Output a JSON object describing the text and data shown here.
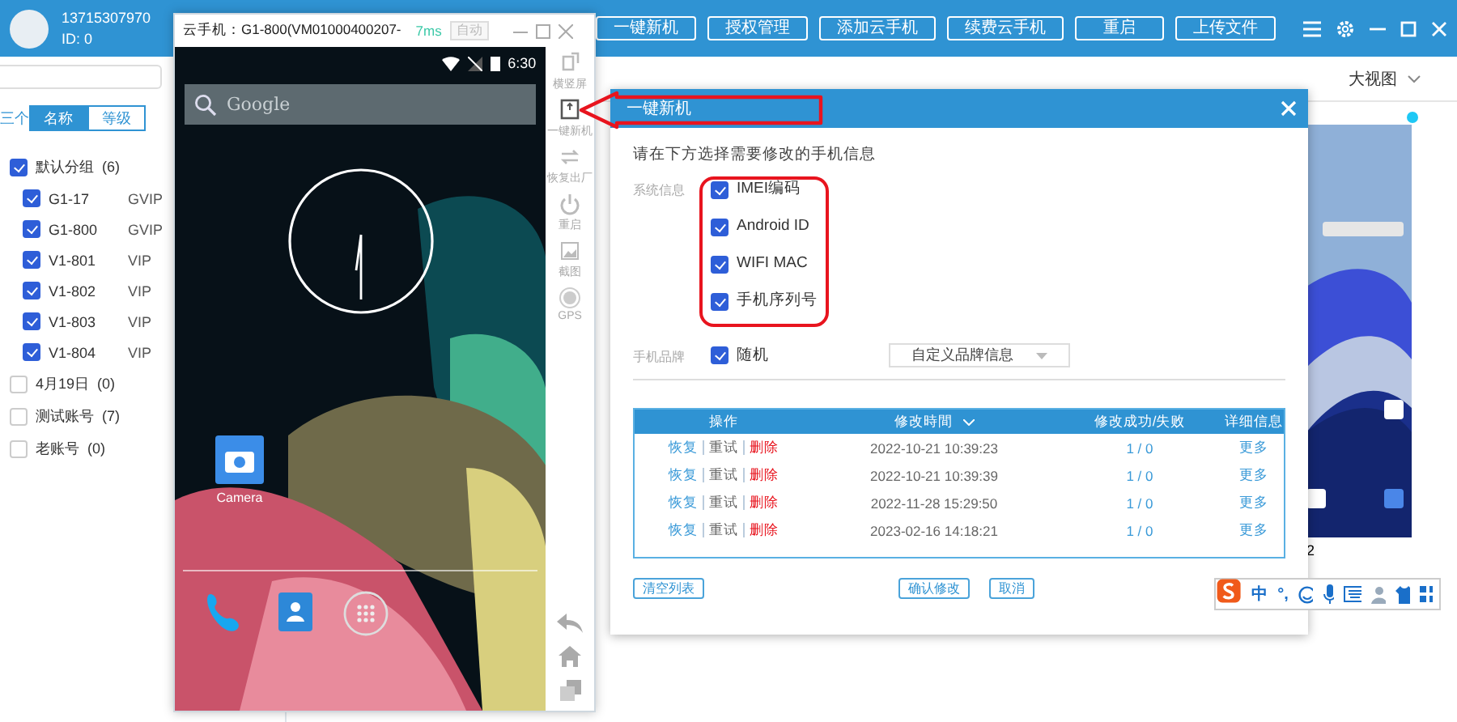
{
  "header": {
    "account": "13715307970",
    "user_id": "ID: 0",
    "buttons": [
      "一键新机",
      "授权管理",
      "添加云手机",
      "续费云手机",
      "重启",
      "上传文件"
    ]
  },
  "sidebar": {
    "sort_label": "三个",
    "sort_tabs": [
      {
        "label": "名称",
        "selected": true
      },
      {
        "label": "等级",
        "selected": false
      }
    ],
    "groups": [
      {
        "name": "默认分组",
        "count": "(6)",
        "checked": true,
        "children": [
          {
            "name": "G1-17",
            "grade": "GVIP",
            "checked": true
          },
          {
            "name": "G1-800",
            "grade": "GVIP",
            "checked": true
          },
          {
            "name": "V1-801",
            "grade": "VIP",
            "checked": true
          },
          {
            "name": "V1-802",
            "grade": "VIP",
            "checked": true
          },
          {
            "name": "V1-803",
            "grade": "VIP",
            "checked": true
          },
          {
            "name": "V1-804",
            "grade": "VIP",
            "checked": true
          }
        ]
      },
      {
        "name": "4月19日",
        "count": "(0)",
        "checked": false
      },
      {
        "name": "测试账号",
        "count": "(7)",
        "checked": false
      },
      {
        "name": "老账号",
        "count": "(0)",
        "checked": false
      }
    ]
  },
  "main": {
    "view_menu": "大视图",
    "devices": [
      {
        "label": "2",
        "online": true
      }
    ]
  },
  "phone_window": {
    "title": "云手机：G1-800(VM01000400207-",
    "ping": "7ms",
    "auto_button": "自动",
    "status_time": "6:30",
    "search_placeholder": "Google",
    "apps": [
      {
        "label": "Camera"
      }
    ],
    "side_tools": [
      "横竖屏",
      "一键新机",
      "恢复出厂",
      "重启",
      "截图",
      "GPS"
    ]
  },
  "dialog": {
    "title": "一键新机",
    "prompt": "请在下方选择需要修改的手机信息",
    "system_label": "系统信息",
    "system_options": [
      {
        "label": "IMEI编码",
        "checked": true
      },
      {
        "label": "Android ID",
        "checked": true
      },
      {
        "label": "WIFI MAC",
        "checked": true
      },
      {
        "label": "手机序列号",
        "checked": true
      }
    ],
    "brand_label": "手机品牌",
    "brand_random": {
      "label": "随机",
      "checked": true
    },
    "brand_select": "自定义品牌信息",
    "table": {
      "columns": [
        "操作",
        "修改時間",
        "修改成功/失败",
        "详细信息"
      ],
      "rows": [
        {
          "actions": [
            "恢复",
            "重试",
            "删除"
          ],
          "time": "2022-10-21 10:39:23",
          "result": "1 / 0",
          "detail": "更多"
        },
        {
          "actions": [
            "恢复",
            "重试",
            "删除"
          ],
          "time": "2022-10-21 10:39:39",
          "result": "1 / 0",
          "detail": "更多"
        },
        {
          "actions": [
            "恢复",
            "重试",
            "删除"
          ],
          "time": "2022-11-28 15:29:50",
          "result": "1 / 0",
          "detail": "更多"
        },
        {
          "actions": [
            "恢复",
            "重试",
            "删除"
          ],
          "time": "2023-02-16 14:18:21",
          "result": "1 / 0",
          "detail": "更多"
        }
      ]
    },
    "buttons": [
      "清空列表",
      "确认修改",
      "取消"
    ]
  },
  "ime_bar": {
    "mode": "中",
    "punct": "°,"
  }
}
